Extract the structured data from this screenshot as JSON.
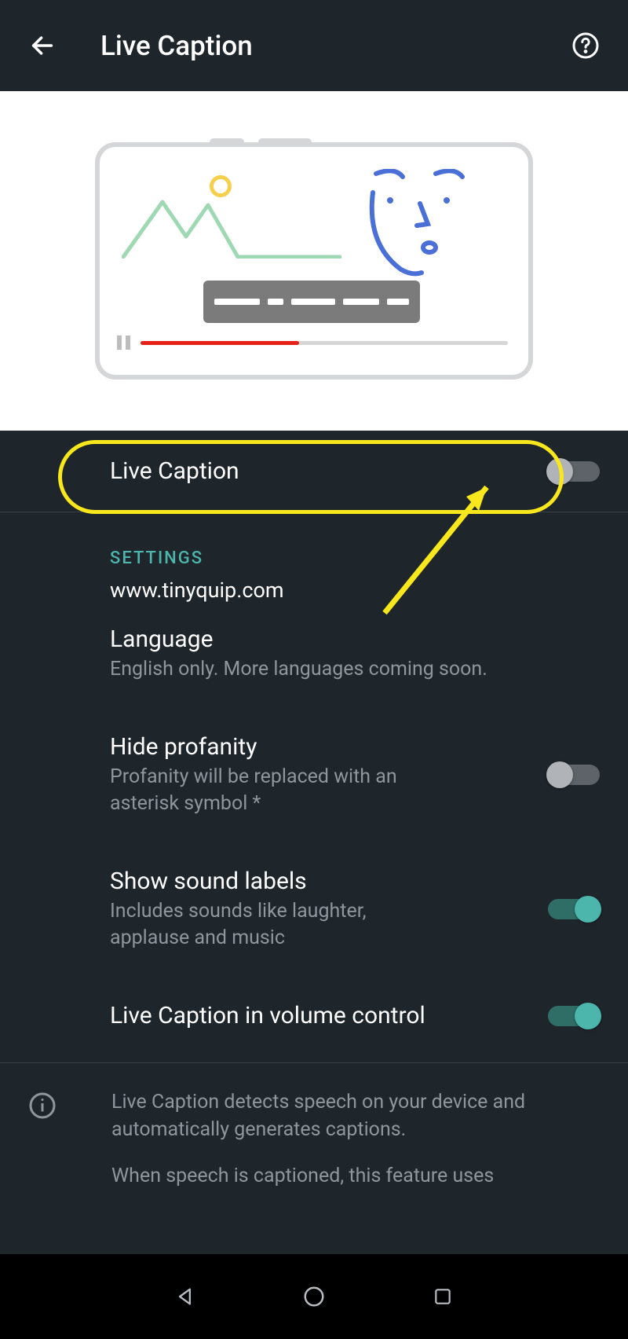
{
  "header": {
    "title": "Live Caption"
  },
  "main_toggle": {
    "label": "Live Caption",
    "on": false
  },
  "section_label": "SETTINGS",
  "watermark": "www.tinyquip.com",
  "settings": {
    "language": {
      "title": "Language",
      "sub": "English only. More languages coming soon."
    },
    "profanity": {
      "title": "Hide profanity",
      "sub": "Profanity will be replaced with an asterisk symbol *",
      "on": false
    },
    "sound_labels": {
      "title": "Show sound labels",
      "sub": "Includes sounds like laughter, applause and music",
      "on": true
    },
    "volume_control": {
      "title": "Live Caption in volume control",
      "on": true
    }
  },
  "info": {
    "p1": "Live Caption detects speech on your device and automatically generates captions.",
    "p2": "When speech is captioned, this feature uses"
  }
}
